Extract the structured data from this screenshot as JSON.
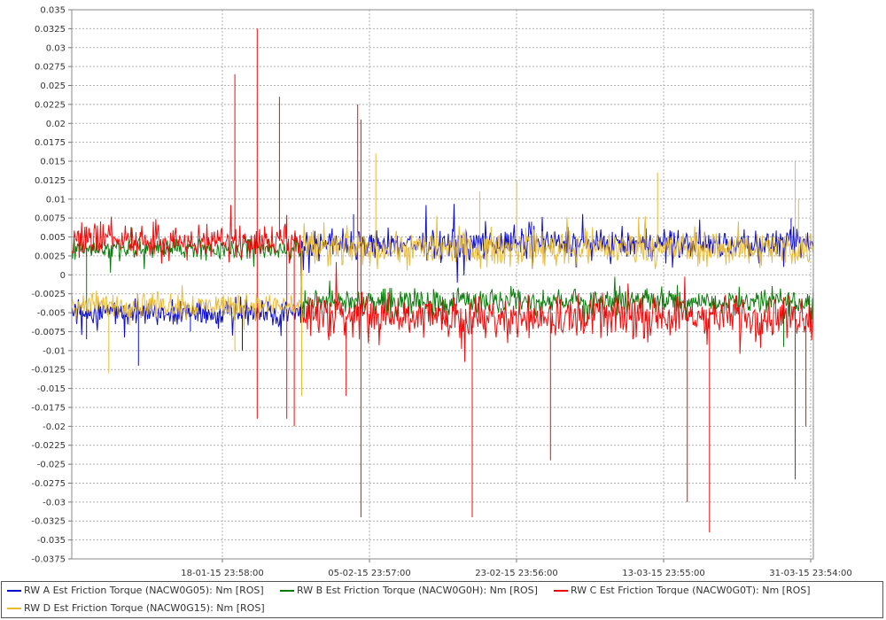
{
  "chart_data": {
    "type": "line",
    "title": "",
    "xlabel": "",
    "ylabel": "",
    "ylim": [
      -0.0375,
      0.035
    ],
    "y_ticks": [
      "0.035",
      "0.0325",
      "0.03",
      "0.0275",
      "0.025",
      "0.0225",
      "0.02",
      "0.0175",
      "0.015",
      "0.0125",
      "0.01",
      "0.0075",
      "0.005",
      "0.0025",
      "0",
      "-0.0025",
      "-0.005",
      "-0.0075",
      "-0.01",
      "-0.0125",
      "-0.015",
      "-0.0175",
      "-0.02",
      "-0.0225",
      "-0.025",
      "-0.0275",
      "-0.03",
      "-0.0325",
      "-0.035",
      "-0.0375"
    ],
    "y_tick_values": [
      0.035,
      0.0325,
      0.03,
      0.0275,
      0.025,
      0.0225,
      0.02,
      0.0175,
      0.015,
      0.0125,
      0.01,
      0.0075,
      0.005,
      0.0025,
      0,
      -0.0025,
      -0.005,
      -0.0075,
      -0.01,
      -0.0125,
      -0.015,
      -0.0175,
      -0.02,
      -0.0225,
      -0.025,
      -0.0275,
      -0.03,
      -0.0325,
      -0.035,
      -0.0375
    ],
    "x_ticks": [
      "18-01-15 23:58:00",
      "05-02-15 23:57:00",
      "23-02-15 23:56:00",
      "13-03-15 23:55:00",
      "31-03-15 23:54:00"
    ],
    "grid": true,
    "legend_position": "bottom",
    "series": [
      {
        "name": "RW A Est Friction Torque (NACW0G05): Nm [ROS]",
        "color": "#0000cc",
        "segments": [
          {
            "x_range": [
              0.0,
              0.31
            ],
            "mean": -0.005,
            "noise": 0.0018
          },
          {
            "x_range": [
              0.31,
              1.0
            ],
            "mean": 0.004,
            "noise": 0.002
          }
        ],
        "spikes": [
          [
            0.02,
            -0.0085
          ],
          [
            0.09,
            -0.012
          ],
          [
            0.16,
            -0.0075
          ],
          [
            0.23,
            -0.01
          ],
          [
            0.38,
            0.008
          ],
          [
            0.62,
            0.007
          ],
          [
            0.97,
            0.0075
          ]
        ]
      },
      {
        "name": "RW B Est Friction Torque (NACW0G0H): Nm [ROS]",
        "color": "#007700",
        "segments": [
          {
            "x_range": [
              0.0,
              0.31
            ],
            "mean": 0.0035,
            "noise": 0.0015
          },
          {
            "x_range": [
              0.31,
              1.0
            ],
            "mean": -0.0035,
            "noise": 0.0018
          }
        ],
        "spikes": [
          [
            0.02,
            -0.005
          ],
          [
            0.96,
            -0.0095
          ],
          [
            0.975,
            -0.027
          ],
          [
            0.5,
            -0.0065
          ]
        ]
      },
      {
        "name": "RW C Est Friction Torque (NACW0G0T): Nm [ROS]",
        "color": "#ee0000",
        "segments": [
          {
            "x_range": [
              0.0,
              0.31
            ],
            "mean": 0.0045,
            "noise": 0.0025
          },
          {
            "x_range": [
              0.31,
              1.0
            ],
            "mean": -0.0055,
            "noise": 0.0028
          }
        ],
        "spikes": [
          [
            0.22,
            0.0265
          ],
          [
            0.25,
            0.0325
          ],
          [
            0.25,
            -0.019
          ],
          [
            0.28,
            0.0235
          ],
          [
            0.29,
            -0.019
          ],
          [
            0.3,
            -0.02
          ],
          [
            0.385,
            0.0225
          ],
          [
            0.39,
            -0.032
          ],
          [
            0.39,
            0.0205
          ],
          [
            0.54,
            -0.032
          ],
          [
            0.645,
            -0.0245
          ],
          [
            0.86,
            -0.034
          ],
          [
            0.99,
            -0.02
          ],
          [
            0.37,
            -0.016
          ],
          [
            0.83,
            -0.03
          ]
        ]
      },
      {
        "name": "RW D Est Friction Torque (NACW0G15): Nm [ROS]",
        "color": "#e8b830",
        "segments": [
          {
            "x_range": [
              0.0,
              0.31
            ],
            "mean": -0.004,
            "noise": 0.0018
          },
          {
            "x_range": [
              0.31,
              1.0
            ],
            "mean": 0.0035,
            "noise": 0.0025
          }
        ],
        "spikes": [
          [
            0.05,
            -0.013
          ],
          [
            0.22,
            -0.01
          ],
          [
            0.31,
            -0.016
          ],
          [
            0.41,
            0.016
          ],
          [
            0.55,
            0.011
          ],
          [
            0.6,
            0.0125
          ],
          [
            0.79,
            0.0135
          ],
          [
            0.975,
            0.015
          ],
          [
            0.98,
            0.01
          ]
        ]
      }
    ]
  },
  "legend": {
    "items": [
      "RW A Est Friction Torque (NACW0G05): Nm [ROS]",
      "RW B Est Friction Torque (NACW0G0H): Nm [ROS]",
      "RW C Est Friction Torque (NACW0G0T): Nm [ROS]",
      "RW D Est Friction Torque (NACW0G15): Nm [ROS]"
    ]
  }
}
